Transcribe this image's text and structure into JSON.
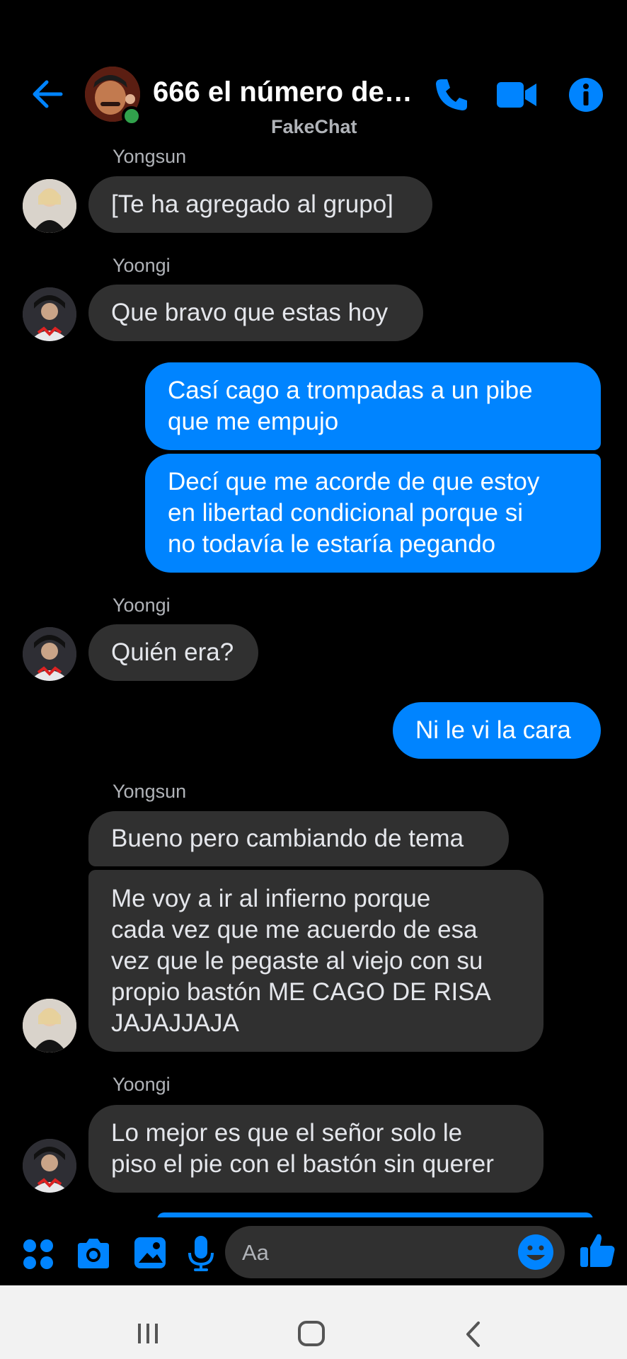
{
  "header": {
    "title": "666 el número de l...",
    "subtitle": "FakeChat",
    "icons": {
      "back": "arrow-left-icon",
      "call": "phone-icon",
      "video": "video-camera-icon",
      "info": "info-icon"
    }
  },
  "messages": [
    {
      "sender": "Yongsun",
      "text": "[Te ha agregado al grupo]",
      "side": "incoming"
    },
    {
      "sender": "Yoongi",
      "text": "Que bravo que estas hoy",
      "side": "incoming"
    },
    {
      "sender": "",
      "text": "Casí cago a trompadas a un pibe\nque me empujo",
      "side": "outgoing"
    },
    {
      "sender": "",
      "text": "Decí que me acorde de que estoy\nen libertad condicional porque si\nno todavía le estaría pegando",
      "side": "outgoing"
    },
    {
      "sender": "Yoongi",
      "text": "Quién era?",
      "side": "incoming"
    },
    {
      "sender": "",
      "text": "Ni le vi la cara",
      "side": "outgoing"
    },
    {
      "sender": "Yongsun",
      "text": "Bueno pero cambiando de tema",
      "side": "incoming"
    },
    {
      "sender": "",
      "text": "Me voy a ir al infierno porque\ncada vez que me acuerdo de esa\nvez que le pegaste al viejo con su\npropio bastón ME CAGO DE RISA\nJAJAJJAJA",
      "side": "incoming"
    },
    {
      "sender": "Yoongi",
      "text": "Lo mejor es que el señor solo le\npiso el pie con el bastón sin querer",
      "side": "incoming"
    }
  ],
  "input": {
    "placeholder": "Aa",
    "icons": [
      "apps-icon",
      "camera-icon",
      "gallery-icon",
      "mic-icon",
      "emoji-icon",
      "thumbs-up-icon"
    ]
  },
  "colors": {
    "accent": "#0084ff",
    "incoming_bubble": "#303030",
    "background": "#000000"
  }
}
